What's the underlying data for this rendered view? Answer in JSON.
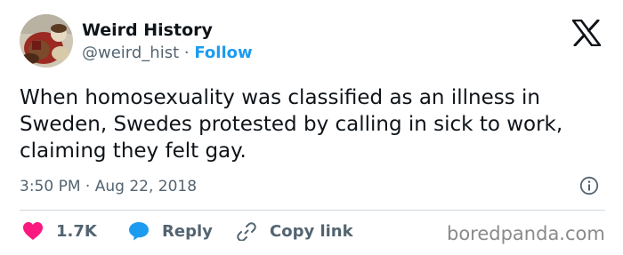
{
  "author": {
    "name": "Weird History",
    "handle": "@weird_hist",
    "separator": "·",
    "follow_label": "Follow"
  },
  "tweet": {
    "text": "When homosexuality was classified as an illness in Sweden, Swedes protested by calling in sick to work, claiming they felt gay."
  },
  "meta": {
    "time": "3:50 PM",
    "separator": "·",
    "date": "Aug 22, 2018"
  },
  "actions": {
    "like_count": "1.7K",
    "reply_label": "Reply",
    "copy_label": "Copy link"
  },
  "watermark": "boredpanda.com",
  "colors": {
    "like": "#f91880",
    "reply": "#1d9bf0",
    "follow": "#1d9bf0",
    "text": "#0f1419",
    "secondary": "#536471"
  },
  "icons": [
    "x-logo-icon",
    "info-icon",
    "heart-icon",
    "speech-bubble-icon",
    "link-icon"
  ]
}
